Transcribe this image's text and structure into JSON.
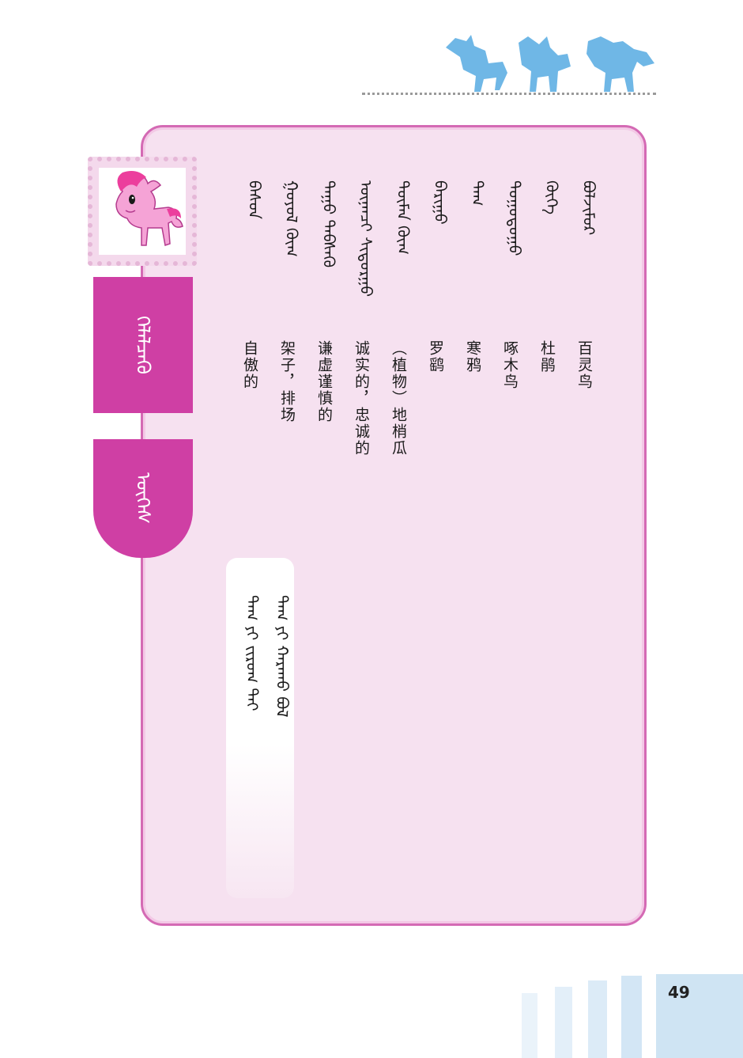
{
  "header": {
    "decoration": "pony-silhouettes",
    "accent_color": "#6fb7e6"
  },
  "sidebar": {
    "stamp_image": "pink-pony-illustration",
    "tab_color": "#cf3fa4",
    "tabs": [
      {
        "label": "ᠬᠡᠯᠡᠯᠴᠡᠬᠦ"
      },
      {
        "label": "ᠦᠭᠡᠰ"
      }
    ]
  },
  "vocabulary": [
    {
      "mongolian": "ᠪᠣᠯᠵᠢᠮᠤᠷ",
      "chinese": "百灵鸟"
    },
    {
      "mongolian": "ᠬᠦᠬᠡ",
      "chinese": "杜鹃"
    },
    {
      "mongolian": "ᠳᠣᠭᠣᠲᠤᠭᠤ",
      "chinese": "啄木鸟"
    },
    {
      "mongolian": "ᠲᠠᠭ",
      "chinese": "寒鸦"
    },
    {
      "mongolian": "ᠪᠠᠷᠢᠭᠤ",
      "chinese": "罗鹞"
    },
    {
      "mongolian": "ᠲᠦᠮᠡᠨ ᠬᠦᠬ",
      "chinese": "（植物）地梢瓜"
    },
    {
      "mongolian": "ᠦᠨᠡᠨᠴᠢ ᠰᠢᠳᠤᠷᠭᠤ",
      "chinese": "诚实的，忠诚的"
    },
    {
      "mongolian": "ᠳᠠᠭᠤ ᠳᠡᠪᠰᠡᠬᠦ",
      "chinese": "谦虚谨慎的"
    },
    {
      "mongolian": "ᠭᠣᠶᠣᠯ ᠬᠦᠬ",
      "chinese": "架子，排场"
    },
    {
      "mongolian": "ᠪᠠᠰᠤᠨ",
      "chinese": "自傲的"
    }
  ],
  "note": {
    "lines": [
      "ᠲᠠᠭ ᠶᠢ ᠬᠠᠷᠠᠬᠤ ᠪᠣᠯ",
      "ᠲᠠᠭ ᠶᠢ ᠵᠢᠷᠤᠭ ᠲᠠᠢ"
    ]
  },
  "page": {
    "number": "49"
  }
}
